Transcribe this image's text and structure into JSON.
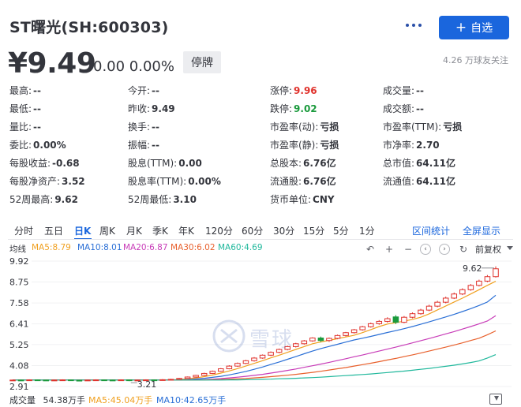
{
  "header": {
    "stock_name": "ST曙光(SH:600303)",
    "follow_label": "自选",
    "follow_icon": "plus-icon",
    "more_icon": "more-dots-icon"
  },
  "price": {
    "current": "¥9.49",
    "change": "0.00 0.00%",
    "status": "停牌",
    "followers": "4.26 万球友关注"
  },
  "quote": {
    "rows": [
      [
        {
          "label": "最高:",
          "value": "--"
        },
        {
          "label": "今开:",
          "value": "--"
        },
        {
          "label": "涨停:",
          "value": "9.96",
          "tone": "red"
        },
        {
          "label": "成交量:",
          "value": "--"
        }
      ],
      [
        {
          "label": "最低:",
          "value": "--"
        },
        {
          "label": "昨收:",
          "value": "9.49"
        },
        {
          "label": "跌停:",
          "value": "9.02",
          "tone": "green"
        },
        {
          "label": "成交额:",
          "value": "--"
        }
      ],
      [
        {
          "label": "量比:",
          "value": "--"
        },
        {
          "label": "换手:",
          "value": "--"
        },
        {
          "label": "市盈率(动):",
          "value": "亏损"
        },
        {
          "label": "市盈率(TTM):",
          "value": "亏损"
        }
      ],
      [
        {
          "label": "委比:",
          "value": "0.00%"
        },
        {
          "label": "振幅:",
          "value": "--"
        },
        {
          "label": "市盈率(静):",
          "value": "亏损"
        },
        {
          "label": "市净率:",
          "value": "2.70"
        }
      ],
      [
        {
          "label": "每股收益:",
          "value": "-0.68"
        },
        {
          "label": "股息(TTM):",
          "value": "0.00"
        },
        {
          "label": "总股本:",
          "value": "6.76亿"
        },
        {
          "label": "总市值:",
          "value": "64.11亿"
        }
      ],
      [
        {
          "label": "每股净资产:",
          "value": "3.52"
        },
        {
          "label": "股息率(TTM):",
          "value": "0.00%"
        },
        {
          "label": "流通股:",
          "value": "6.76亿"
        },
        {
          "label": "流通值:",
          "value": "64.11亿"
        }
      ],
      [
        {
          "label": "52周最高:",
          "value": "9.62"
        },
        {
          "label": "52周最低:",
          "value": "3.10"
        },
        {
          "label": "货币单位:",
          "value": "CNY"
        },
        {
          "label": "",
          "value": ""
        }
      ]
    ]
  },
  "tabs": {
    "items": [
      "分时",
      "五日",
      "日K",
      "周K",
      "月K",
      "季K",
      "年K",
      "120分",
      "60分",
      "30分",
      "15分",
      "5分",
      "1分"
    ],
    "active": "日K",
    "interval_stats": "区间统计",
    "fullscreen": "全屏显示"
  },
  "ma": {
    "label": "均线",
    "items": [
      {
        "text": "MA5:8.79",
        "color": "#f0a020"
      },
      {
        "text": "MA10:8.01",
        "color": "#2a6fd6"
      },
      {
        "text": "MA20:6.87",
        "color": "#c83cb8"
      },
      {
        "text": "MA30:6.02",
        "color": "#e8602c"
      },
      {
        "text": "MA60:4.69",
        "color": "#20b89c"
      }
    ],
    "adjust": "前复权",
    "tool_icons": [
      "undo-icon",
      "zoom-in-icon",
      "zoom-out-icon",
      "pan-left-icon",
      "pan-right-icon",
      "reset-icon"
    ]
  },
  "volume": {
    "label": "成交量",
    "value": "54.38万手",
    "ma5": "MA5:45.04万手",
    "ma10": "MA10:42.65万手",
    "ma5_color": "#f0a020",
    "ma10_color": "#2a6fd6"
  },
  "watermark": {
    "text": "雪球",
    "icon": "snowball-logo-icon"
  },
  "chart_data": {
    "type": "candlestick",
    "y_ticks": [
      "9.92",
      "8.75",
      "7.58",
      "6.41",
      "5.25",
      "4.08",
      "2.91"
    ],
    "ylim": [
      2.91,
      9.92
    ],
    "max_marker": "9.62",
    "min_marker": "3.21",
    "up_color": "#e0322c",
    "down_color": "#1a9a3c",
    "candles": [
      [
        3.26,
        3.27,
        3.24,
        3.29
      ],
      [
        3.27,
        3.26,
        3.23,
        3.3
      ],
      [
        3.26,
        3.28,
        3.24,
        3.31
      ],
      [
        3.28,
        3.27,
        3.25,
        3.3
      ],
      [
        3.27,
        3.26,
        3.24,
        3.29
      ],
      [
        3.26,
        3.27,
        3.23,
        3.3
      ],
      [
        3.27,
        3.28,
        3.25,
        3.31
      ],
      [
        3.28,
        3.26,
        3.24,
        3.3
      ],
      [
        3.26,
        3.25,
        3.22,
        3.28
      ],
      [
        3.25,
        3.27,
        3.23,
        3.29
      ],
      [
        3.27,
        3.28,
        3.25,
        3.31
      ],
      [
        3.28,
        3.27,
        3.25,
        3.3
      ],
      [
        3.27,
        3.26,
        3.24,
        3.29
      ],
      [
        3.26,
        3.28,
        3.24,
        3.31
      ],
      [
        3.28,
        3.26,
        3.21,
        3.3
      ],
      [
        3.26,
        3.27,
        3.23,
        3.29
      ],
      [
        3.27,
        3.28,
        3.25,
        3.31
      ],
      [
        3.28,
        3.27,
        3.25,
        3.3
      ],
      [
        3.27,
        3.29,
        3.25,
        3.32
      ],
      [
        3.29,
        3.31,
        3.27,
        3.34
      ],
      [
        3.31,
        3.36,
        3.29,
        3.39
      ],
      [
        3.36,
        3.44,
        3.34,
        3.47
      ],
      [
        3.44,
        3.53,
        3.41,
        3.56
      ],
      [
        3.53,
        3.64,
        3.5,
        3.68
      ],
      [
        3.64,
        3.76,
        3.61,
        3.8
      ],
      [
        3.76,
        3.9,
        3.73,
        3.94
      ],
      [
        3.9,
        4.05,
        3.87,
        4.1
      ],
      [
        4.05,
        4.2,
        4.01,
        4.25
      ],
      [
        4.2,
        4.35,
        4.16,
        4.4
      ],
      [
        4.35,
        4.5,
        4.3,
        4.55
      ],
      [
        4.5,
        4.66,
        4.46,
        4.7
      ],
      [
        4.66,
        4.82,
        4.61,
        4.87
      ],
      [
        4.82,
        4.98,
        4.77,
        5.03
      ],
      [
        4.98,
        5.14,
        4.93,
        5.19
      ],
      [
        5.14,
        5.3,
        5.09,
        5.35
      ],
      [
        5.3,
        5.46,
        5.25,
        5.51
      ],
      [
        5.46,
        5.62,
        5.41,
        5.66
      ],
      [
        5.62,
        5.48,
        5.4,
        5.7
      ],
      [
        5.48,
        5.6,
        5.4,
        5.65
      ],
      [
        5.6,
        5.76,
        5.55,
        5.81
      ],
      [
        5.76,
        5.92,
        5.71,
        5.96
      ],
      [
        5.92,
        6.08,
        5.87,
        6.13
      ],
      [
        6.08,
        6.25,
        6.03,
        6.3
      ],
      [
        6.25,
        6.42,
        6.2,
        6.48
      ],
      [
        6.42,
        6.55,
        6.36,
        6.62
      ],
      [
        6.55,
        6.7,
        6.48,
        6.78
      ],
      [
        6.8,
        6.5,
        6.4,
        6.9
      ],
      [
        6.5,
        6.78,
        6.45,
        6.85
      ],
      [
        6.78,
        6.98,
        6.72,
        7.05
      ],
      [
        6.98,
        7.18,
        6.92,
        7.25
      ],
      [
        7.18,
        7.4,
        7.12,
        7.48
      ],
      [
        7.4,
        7.62,
        7.34,
        7.7
      ],
      [
        7.62,
        7.85,
        7.56,
        7.93
      ],
      [
        7.85,
        8.08,
        7.8,
        8.16
      ],
      [
        8.08,
        8.32,
        8.02,
        8.4
      ],
      [
        8.32,
        8.56,
        8.26,
        8.64
      ],
      [
        8.56,
        8.8,
        8.5,
        8.88
      ],
      [
        8.8,
        9.05,
        8.74,
        9.14
      ],
      [
        9.05,
        9.49,
        9.0,
        9.62
      ]
    ],
    "ma_series": [
      {
        "name": "MA5",
        "color": "#f0a020",
        "values": [
          3.27,
          3.27,
          3.27,
          3.27,
          3.27,
          3.27,
          3.27,
          3.27,
          3.27,
          3.27,
          3.27,
          3.27,
          3.27,
          3.27,
          3.27,
          3.27,
          3.27,
          3.27,
          3.28,
          3.28,
          3.3,
          3.34,
          3.39,
          3.46,
          3.55,
          3.66,
          3.78,
          3.91,
          4.05,
          4.2,
          4.35,
          4.51,
          4.66,
          4.82,
          4.98,
          5.14,
          5.3,
          5.4,
          5.49,
          5.58,
          5.68,
          5.77,
          5.92,
          6.09,
          6.26,
          6.4,
          6.48,
          6.56,
          6.66,
          6.78,
          6.97,
          7.19,
          7.41,
          7.63,
          7.85,
          8.08,
          8.32,
          8.56,
          8.79
        ]
      },
      {
        "name": "MA10",
        "color": "#2a6fd6",
        "values": [
          3.27,
          3.27,
          3.27,
          3.27,
          3.27,
          3.27,
          3.27,
          3.27,
          3.27,
          3.27,
          3.27,
          3.27,
          3.27,
          3.27,
          3.27,
          3.27,
          3.27,
          3.27,
          3.27,
          3.27,
          3.28,
          3.3,
          3.33,
          3.37,
          3.42,
          3.48,
          3.56,
          3.65,
          3.75,
          3.87,
          4.0,
          4.14,
          4.28,
          4.43,
          4.58,
          4.74,
          4.89,
          5.03,
          5.15,
          5.27,
          5.39,
          5.51,
          5.61,
          5.71,
          5.82,
          5.93,
          6.03,
          6.14,
          6.26,
          6.39,
          6.52,
          6.66,
          6.8,
          6.94,
          7.1,
          7.26,
          7.44,
          7.63,
          8.01
        ]
      },
      {
        "name": "MA20",
        "color": "#c83cb8",
        "values": [
          3.27,
          3.27,
          3.27,
          3.27,
          3.27,
          3.27,
          3.27,
          3.27,
          3.27,
          3.27,
          3.27,
          3.27,
          3.27,
          3.27,
          3.27,
          3.27,
          3.27,
          3.27,
          3.27,
          3.27,
          3.27,
          3.28,
          3.29,
          3.3,
          3.32,
          3.35,
          3.39,
          3.43,
          3.48,
          3.53,
          3.59,
          3.66,
          3.73,
          3.81,
          3.89,
          3.98,
          4.07,
          4.16,
          4.26,
          4.36,
          4.46,
          4.57,
          4.67,
          4.78,
          4.89,
          5.0,
          5.11,
          5.23,
          5.35,
          5.47,
          5.59,
          5.72,
          5.85,
          5.98,
          6.12,
          6.26,
          6.41,
          6.57,
          6.87
        ]
      },
      {
        "name": "MA30",
        "color": "#e8602c",
        "values": [
          3.27,
          3.27,
          3.27,
          3.27,
          3.27,
          3.27,
          3.27,
          3.27,
          3.27,
          3.27,
          3.27,
          3.27,
          3.27,
          3.27,
          3.27,
          3.27,
          3.27,
          3.27,
          3.27,
          3.27,
          3.27,
          3.27,
          3.27,
          3.28,
          3.29,
          3.3,
          3.32,
          3.34,
          3.36,
          3.39,
          3.42,
          3.46,
          3.5,
          3.54,
          3.59,
          3.64,
          3.7,
          3.76,
          3.83,
          3.9,
          3.97,
          4.05,
          4.13,
          4.21,
          4.3,
          4.39,
          4.48,
          4.58,
          4.68,
          4.78,
          4.89,
          5.0,
          5.11,
          5.23,
          5.35,
          5.48,
          5.61,
          5.8,
          6.02
        ]
      },
      {
        "name": "MA60",
        "color": "#20b89c",
        "values": [
          3.27,
          3.27,
          3.27,
          3.27,
          3.27,
          3.27,
          3.27,
          3.27,
          3.27,
          3.27,
          3.27,
          3.27,
          3.27,
          3.27,
          3.27,
          3.27,
          3.27,
          3.27,
          3.27,
          3.27,
          3.27,
          3.27,
          3.27,
          3.27,
          3.27,
          3.27,
          3.28,
          3.28,
          3.29,
          3.3,
          3.31,
          3.32,
          3.34,
          3.35,
          3.37,
          3.39,
          3.41,
          3.43,
          3.46,
          3.49,
          3.52,
          3.55,
          3.58,
          3.61,
          3.65,
          3.69,
          3.73,
          3.77,
          3.82,
          3.87,
          3.92,
          3.98,
          4.04,
          4.1,
          4.17,
          4.25,
          4.34,
          4.5,
          4.69
        ]
      }
    ]
  }
}
